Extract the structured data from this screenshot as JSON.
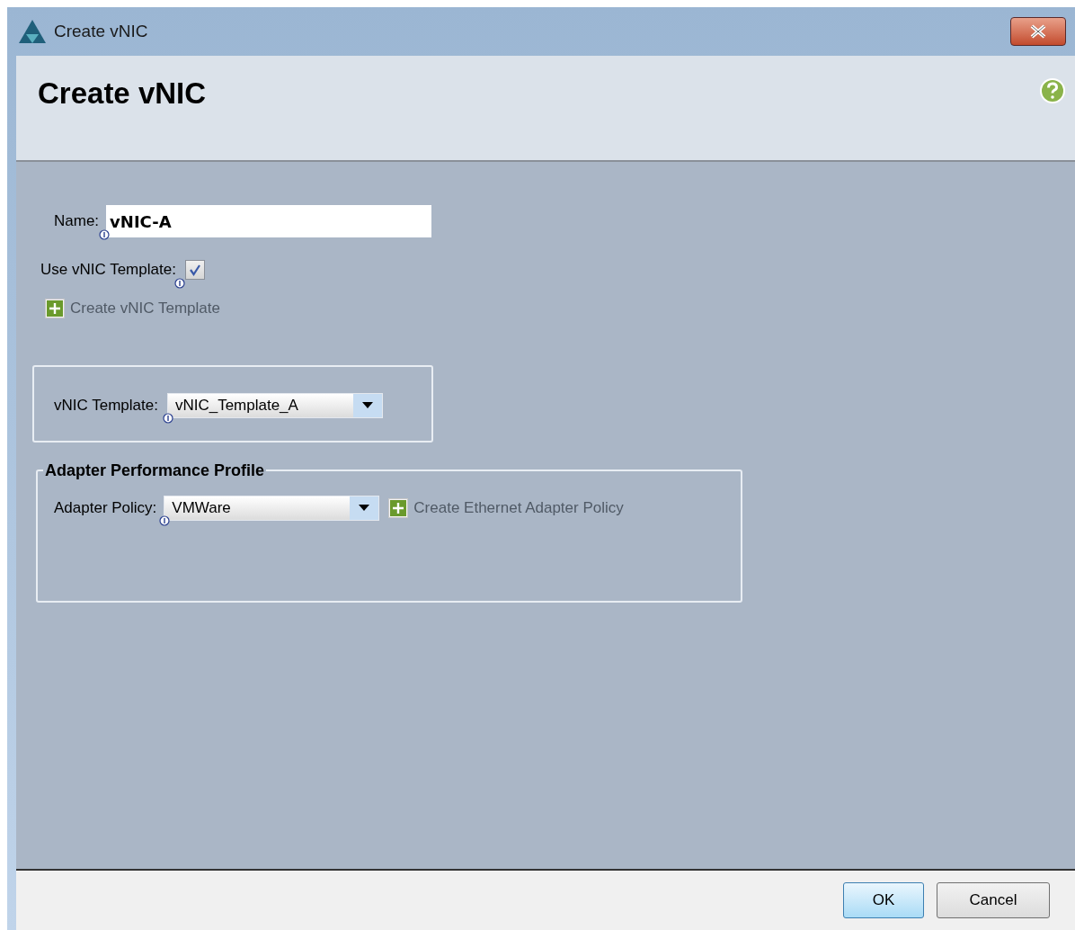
{
  "window": {
    "title": "Create vNIC"
  },
  "header": {
    "title": "Create vNIC"
  },
  "name_field": {
    "label": "Name:",
    "value": "vNIC-A"
  },
  "use_template": {
    "label": "Use vNIC Template:",
    "checked": true
  },
  "create_template_link": "Create vNIC Template",
  "template_select": {
    "label": "vNIC Template:",
    "value": "vNIC_Template_A"
  },
  "adapter_profile": {
    "title": "Adapter Performance Profile",
    "policy_label": "Adapter Policy:",
    "policy_value": "VMWare",
    "create_policy_link": "Create Ethernet Adapter Policy"
  },
  "buttons": [
    {
      "label": "OK",
      "default": true
    },
    {
      "label": "Cancel",
      "default": false
    }
  ]
}
